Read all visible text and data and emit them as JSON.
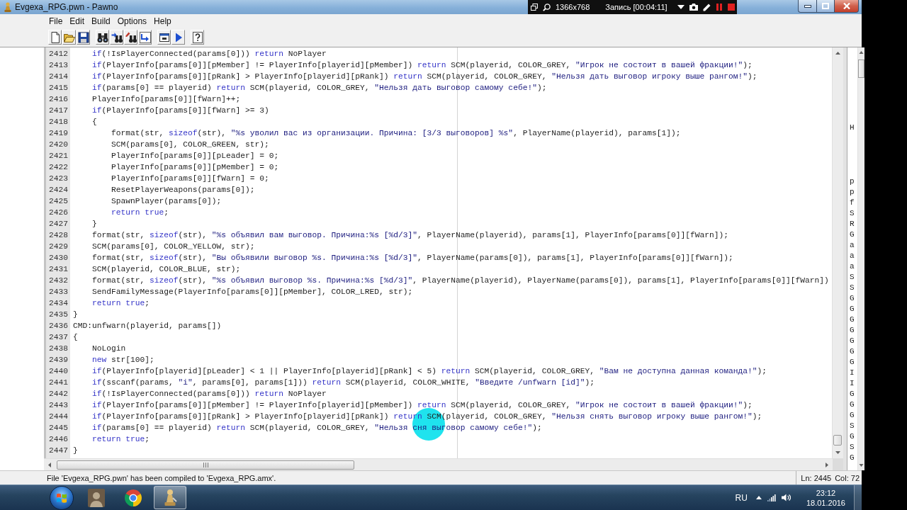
{
  "window": {
    "title": "Evgexa_RPG.pwn - Pawno"
  },
  "recorder": {
    "resolution": "1366x768",
    "recording": "Запись [00:04:11]"
  },
  "menu": [
    "File",
    "Edit",
    "Build",
    "Options",
    "Help"
  ],
  "editor": {
    "lines": [
      {
        "children": [
          {
            "number": "2412",
            "tokens": [
              {
                "kind": "keyword",
                "text": "if"
              },
              {
                "kind": "plain",
                "text": "(!IsPlayerConnected(params[0])) "
              },
              {
                "kind": "keyword",
                "text": "return"
              },
              {
                "kind": "plain",
                "text": " NoPlayer"
              }
            ]
          },
          {
            "number": "2413",
            "tokens": [
              {
                "kind": "keyword",
                "text": "if"
              },
              {
                "kind": "plain",
                "text": "(PlayerInfo[params[0]][pMember] != PlayerInfo[playerid][pMember]) "
              },
              {
                "kind": "keyword",
                "text": "return"
              },
              {
                "kind": "plain",
                "text": " SCM(playerid, COLOR_GREY, "
              },
              {
                "kind": "string",
                "text": "\"Игрок не состоит в вашей фракции!\""
              },
              {
                "kind": "plain",
                "text": ");"
              }
            ]
          },
          {
            "number": "2414",
            "tokens": [
              {
                "kind": "keyword",
                "text": "if"
              },
              {
                "kind": "plain",
                "text": "(PlayerInfo[params[0]][pRank] > PlayerInfo[playerid][pRank]) "
              },
              {
                "kind": "keyword",
                "text": "return"
              },
              {
                "kind": "plain",
                "text": " SCM(playerid, COLOR_GREY, "
              },
              {
                "kind": "string",
                "text": "\"Нельзя дать выговор игроку выше рангом!\""
              },
              {
                "kind": "plain",
                "text": ");"
              }
            ]
          },
          {
            "number": "2415",
            "tokens": [
              {
                "kind": "keyword",
                "text": "if"
              },
              {
                "kind": "plain",
                "text": "(params[0] == playerid) "
              },
              {
                "kind": "keyword",
                "text": "return"
              },
              {
                "kind": "plain",
                "text": " SCM(playerid, COLOR_GREY, "
              },
              {
                "kind": "string",
                "text": "\"Нельзя дать выговор самому себе!\""
              },
              {
                "kind": "plain",
                "text": ");"
              }
            ]
          },
          {
            "number": "2416",
            "tokens": [
              {
                "kind": "plain",
                "text": "PlayerInfo[params[0]][fWarn]++;"
              }
            ]
          },
          {
            "number": "2417",
            "tokens": [
              {
                "kind": "keyword",
                "text": "if"
              },
              {
                "kind": "plain",
                "text": "(PlayerInfo[params[0]][fWarn] >= 3)"
              }
            ]
          },
          {
            "number": "2418",
            "tokens": [
              {
                "kind": "plain",
                "text": "{"
              }
            ]
          },
          {
            "children": [
              {
                "number": "2419",
                "tokens": [
                  {
                    "kind": "plain",
                    "text": "format(str, "
                  },
                  {
                    "kind": "keyword",
                    "text": "sizeof"
                  },
                  {
                    "kind": "plain",
                    "text": "(str), "
                  },
                  {
                    "kind": "string",
                    "text": "\"%s уволил вас из организации. Причина: [3/3 выговоров] %s\""
                  },
                  {
                    "kind": "plain",
                    "text": ", PlayerName(playerid), params[1]);"
                  }
                ]
              },
              {
                "number": "2420",
                "tokens": [
                  {
                    "kind": "plain",
                    "text": "SCM(params[0], COLOR_GREEN, str);"
                  }
                ]
              },
              {
                "number": "2421",
                "tokens": [
                  {
                    "kind": "plain",
                    "text": "PlayerInfo[params[0]][pLeader] = 0;"
                  }
                ]
              },
              {
                "number": "2422",
                "tokens": [
                  {
                    "kind": "plain",
                    "text": "PlayerInfo[params[0]][pMember] = 0;"
                  }
                ]
              },
              {
                "number": "2423",
                "tokens": [
                  {
                    "kind": "plain",
                    "text": "PlayerInfo[params[0]][fWarn] = 0;"
                  }
                ]
              },
              {
                "number": "2424",
                "tokens": [
                  {
                    "kind": "plain",
                    "text": "ResetPlayerWeapons(params[0]);"
                  }
                ]
              },
              {
                "number": "2425",
                "tokens": [
                  {
                    "kind": "plain",
                    "text": "SpawnPlayer(params[0]);"
                  }
                ]
              },
              {
                "number": "2426",
                "tokens": [
                  {
                    "kind": "keyword",
                    "text": "return true"
                  },
                  {
                    "kind": "plain",
                    "text": ";"
                  }
                ]
              }
            ]
          },
          {
            "number": "2427",
            "tokens": [
              {
                "kind": "plain",
                "text": "}"
              }
            ]
          },
          {
            "number": "2428",
            "tokens": [
              {
                "kind": "plain",
                "text": "format(str, "
              },
              {
                "kind": "keyword",
                "text": "sizeof"
              },
              {
                "kind": "plain",
                "text": "(str), "
              },
              {
                "kind": "string",
                "text": "\"%s объявил вам выговор. Причина:%s [%d/3]\""
              },
              {
                "kind": "plain",
                "text": ", PlayerName(playerid), params[1], PlayerInfo[params[0]][fWarn]);"
              }
            ]
          },
          {
            "number": "2429",
            "tokens": [
              {
                "kind": "plain",
                "text": "SCM(params[0], COLOR_YELLOW, str);"
              }
            ]
          },
          {
            "number": "2430",
            "tokens": [
              {
                "kind": "plain",
                "text": "format(str, "
              },
              {
                "kind": "keyword",
                "text": "sizeof"
              },
              {
                "kind": "plain",
                "text": "(str), "
              },
              {
                "kind": "string",
                "text": "\"Вы объявили выговор %s. Причина:%s [%d/3]\""
              },
              {
                "kind": "plain",
                "text": ", PlayerName(params[0]), params[1], PlayerInfo[params[0]][fWarn]);"
              }
            ]
          },
          {
            "number": "2431",
            "tokens": [
              {
                "kind": "plain",
                "text": "SCM(playerid, COLOR_BLUE, str);"
              }
            ]
          },
          {
            "number": "2432",
            "tokens": [
              {
                "kind": "plain",
                "text": "format(str, "
              },
              {
                "kind": "keyword",
                "text": "sizeof"
              },
              {
                "kind": "plain",
                "text": "(str), "
              },
              {
                "kind": "string",
                "text": "\"%s объявил выговор %s. Причина:%s [%d/3]\""
              },
              {
                "kind": "plain",
                "text": ", PlayerName(playerid), PlayerName(params[0]), params[1], PlayerInfo[params[0]][fWarn])"
              }
            ]
          },
          {
            "number": "2433",
            "tokens": [
              {
                "kind": "plain",
                "text": "SendFamilyMessage(PlayerInfo[params[0]][pMember], COLOR_LRED, str);"
              }
            ]
          },
          {
            "number": "2434",
            "tokens": [
              {
                "kind": "keyword",
                "text": "return true"
              },
              {
                "kind": "plain",
                "text": ";"
              }
            ]
          }
        ]
      },
      {
        "number": "2435",
        "tokens": [
          {
            "kind": "plain",
            "text": "}"
          }
        ]
      },
      {
        "number": "2436",
        "tokens": [
          {
            "kind": "plain",
            "text": "CMD:unfwarn(playerid, params[])"
          }
        ]
      },
      {
        "number": "2437",
        "tokens": [
          {
            "kind": "plain",
            "text": "{"
          }
        ]
      },
      {
        "children": [
          {
            "number": "2438",
            "tokens": [
              {
                "kind": "plain",
                "text": "NoLogin"
              }
            ]
          },
          {
            "number": "2439",
            "tokens": [
              {
                "kind": "keyword",
                "text": "new"
              },
              {
                "kind": "plain",
                "text": " str[100];"
              }
            ]
          },
          {
            "number": "2440",
            "tokens": [
              {
                "kind": "keyword",
                "text": "if"
              },
              {
                "kind": "plain",
                "text": "(PlayerInfo[playerid][pLeader] < 1 || PlayerInfo[playerid][pRank] < 5) "
              },
              {
                "kind": "keyword",
                "text": "return"
              },
              {
                "kind": "plain",
                "text": " SCM(playerid, COLOR_GREY, "
              },
              {
                "kind": "string",
                "text": "\"Вам не доступна данная команда!\""
              },
              {
                "kind": "plain",
                "text": ");"
              }
            ]
          },
          {
            "number": "2441",
            "tokens": [
              {
                "kind": "keyword",
                "text": "if"
              },
              {
                "kind": "plain",
                "text": "(sscanf(params, "
              },
              {
                "kind": "string",
                "text": "\"i\""
              },
              {
                "kind": "plain",
                "text": ", params[0], params[1])) "
              },
              {
                "kind": "keyword",
                "text": "return"
              },
              {
                "kind": "plain",
                "text": " SCM(playerid, COLOR_WHITE, "
              },
              {
                "kind": "string",
                "text": "\"Введите /unfwarn [id]\""
              },
              {
                "kind": "plain",
                "text": ");"
              }
            ]
          },
          {
            "number": "2442",
            "tokens": [
              {
                "kind": "keyword",
                "text": "if"
              },
              {
                "kind": "plain",
                "text": "(!IsPlayerConnected(params[0])) "
              },
              {
                "kind": "keyword",
                "text": "return"
              },
              {
                "kind": "plain",
                "text": " NoPlayer"
              }
            ]
          },
          {
            "number": "2443",
            "tokens": [
              {
                "kind": "keyword",
                "text": "if"
              },
              {
                "kind": "plain",
                "text": "(PlayerInfo[params[0]][pMember] != PlayerInfo[playerid][pMember]) "
              },
              {
                "kind": "keyword",
                "text": "return"
              },
              {
                "kind": "plain",
                "text": " SCM(playerid, COLOR_GREY, "
              },
              {
                "kind": "string",
                "text": "\"Игрок не состоит в вашей фракции!\""
              },
              {
                "kind": "plain",
                "text": ");"
              }
            ]
          },
          {
            "number": "2444",
            "tokens": [
              {
                "kind": "keyword",
                "text": "if"
              },
              {
                "kind": "plain",
                "text": "(PlayerInfo[params[0]][pRank] > PlayerInfo[playerid][pRank]) "
              },
              {
                "kind": "keyword",
                "text": "return"
              },
              {
                "kind": "plain",
                "text": " SCM(playerid, COLOR_GREY, "
              },
              {
                "kind": "string",
                "text": "\"Нельзя снять выговор игроку выше рангом!\""
              },
              {
                "kind": "plain",
                "text": ");"
              }
            ]
          },
          {
            "number": "2445",
            "tokens": [
              {
                "kind": "keyword",
                "text": "if"
              },
              {
                "kind": "plain",
                "text": "(params[0] == playerid) "
              },
              {
                "kind": "keyword",
                "text": "return"
              },
              {
                "kind": "plain",
                "text": " SCM(playerid, COLOR_GREY, "
              },
              {
                "kind": "string",
                "text": "\"Нельзя сня выговор самому себе!\""
              },
              {
                "kind": "plain",
                "text": ");"
              }
            ]
          },
          {
            "number": "2446",
            "tokens": [
              {
                "kind": "keyword",
                "text": "return true"
              },
              {
                "kind": "plain",
                "text": ";"
              }
            ]
          }
        ]
      },
      {
        "number": "2447",
        "tokens": [
          {
            "kind": "plain",
            "text": "}"
          }
        ]
      }
    ]
  },
  "function_list": {
    "groups": [
      {
        "items": [
          "H"
        ]
      },
      {
        "items": [
          "p",
          "p",
          "f",
          "S",
          "R",
          "G",
          "a",
          "a",
          "a",
          "S",
          "S",
          "G",
          "G",
          "G",
          "G",
          "G",
          "G",
          "G",
          "I",
          "I",
          "G",
          "G",
          "G",
          "S",
          "G",
          "S",
          "G"
        ]
      }
    ]
  },
  "status_bar": {
    "message": "File 'Evgexa_RPG.pwn' has been compiled to 'Evgexa_RPG.amx'.",
    "line": "Ln: 2445",
    "column": "Col: 72"
  },
  "taskbar": {
    "apps": [
      {
        "kind": "portrait",
        "selected": false
      },
      {
        "kind": "browser",
        "selected": false
      },
      {
        "kind": "pawn",
        "selected": true
      }
    ],
    "language": "RU",
    "time": "23:12",
    "date": "18.01.2016"
  }
}
